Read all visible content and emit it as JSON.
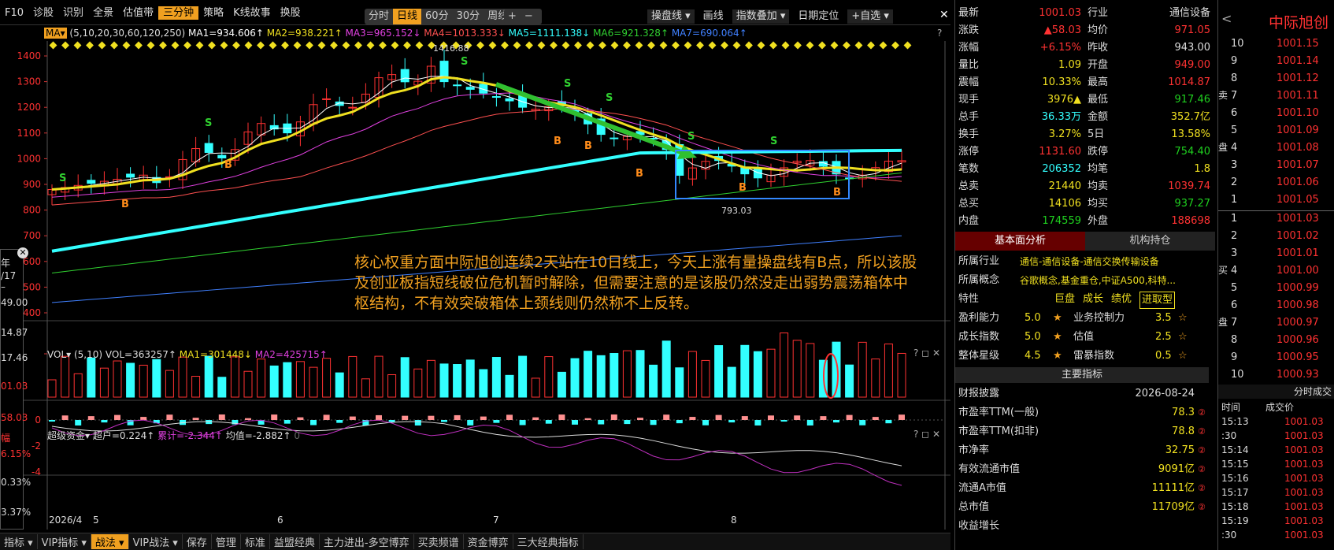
{
  "toolbar": {
    "left": [
      "F10",
      "诊股",
      "识别",
      "全景",
      "估值带",
      "三分钟",
      "策略",
      "K线故事",
      "换股"
    ],
    "active": "三分钟",
    "periods": [
      "分时",
      "日线",
      "60分",
      "30分",
      "周线 ▾"
    ],
    "active_period": "日线",
    "zoom": [
      "+",
      "−"
    ],
    "right": [
      "操盘线 ▾",
      "画线",
      "指数叠加 ▾",
      "日期定位",
      "+自选 ▾"
    ],
    "close": "✕"
  },
  "indicator_line": {
    "ma_btn": "MA▾",
    "params": "(5,10,20,30,60,120,250)",
    "items": [
      {
        "t": "MA1=934.606↑",
        "c": "#ffffff"
      },
      {
        "t": "MA2=938.221↑",
        "c": "#f0e020"
      },
      {
        "t": "MA3=965.152↓",
        "c": "#e040e0"
      },
      {
        "t": "MA4=1013.333↓",
        "c": "#ff5050"
      },
      {
        "t": "MA5=1111.138↓",
        "c": "#33ffff"
      },
      {
        "t": "MA6=921.328↑",
        "c": "#30d030"
      },
      {
        "t": "MA7=690.064↑",
        "c": "#4080ff"
      }
    ],
    "help": "?"
  },
  "price_axis": [
    "1400",
    "1300",
    "1200",
    "1100",
    "1000",
    "900",
    "800",
    "700",
    "600",
    "500",
    "400"
  ],
  "labels": {
    "high": "1416.88",
    "low": "793.03",
    "buy": "B",
    "sell": "S"
  },
  "annotation": "核心权重方面中际旭创连续2天站在10日线上，今天上涨有量操盘线有B点，所以该股及创业板指短线破位危机暂时解除，但需要注意的是该股仍然没走出弱势震荡箱体中枢结构，不有效突破箱体上颈线则仍然称不上反转。",
  "vol_panel": {
    "name": "VOL▾",
    "params": "(5,10)",
    "vol": "VOL=363257↑",
    "ma1": "MA1=301448↓",
    "ma2": "MA2=425715↑",
    "controls": "? ◻ ✕"
  },
  "fund_panel": {
    "name": "超级资金▾",
    "super": "超户=0.224↑",
    "cum": "累计=-2.344↑",
    "avg": "均值=-2.882↑",
    "zero": "0",
    "controls": "? ◻ ✕",
    "axis": [
      "0",
      "-2",
      "-4"
    ]
  },
  "date_axis": [
    "2026/4",
    "5",
    "6",
    "7",
    "8"
  ],
  "left_clip": {
    "lines": [
      "年",
      "/17 –",
      "49.00",
      "14.87",
      "17.46",
      "01.03",
      "58.03",
      "幅",
      "6.15%",
      "0.33%",
      "3.37%"
    ]
  },
  "bottombar": [
    "指标 ▾",
    "VIP指标 ▾",
    "战法 ▾",
    "VIP战法 ▾",
    "保存",
    "管理",
    "标准",
    "益盟经典",
    "主力进出-多空博弈",
    "买卖频谱",
    "资金博弈",
    "三大经典指标"
  ],
  "bottombar_active": "战法 ▾",
  "quote": {
    "rows": [
      [
        [
          "最新",
          "wht"
        ],
        [
          "1001.03",
          "red"
        ],
        [
          "行业",
          "wht"
        ],
        [
          "通信设备",
          "wht"
        ]
      ],
      [
        [
          "涨跌",
          "wht"
        ],
        [
          "▲58.03",
          "red"
        ],
        [
          "均价",
          "wht"
        ],
        [
          "971.05",
          "red"
        ]
      ],
      [
        [
          "涨幅",
          "wht"
        ],
        [
          "+6.15%",
          "red"
        ],
        [
          "昨收",
          "wht"
        ],
        [
          "943.00",
          "wht"
        ]
      ],
      [
        [
          "量比",
          "wht"
        ],
        [
          "1.09",
          "yel"
        ],
        [
          "开盘",
          "wht"
        ],
        [
          "949.00",
          "red"
        ]
      ],
      [
        [
          "震幅",
          "wht"
        ],
        [
          "10.33%",
          "yel"
        ],
        [
          "最高",
          "wht"
        ],
        [
          "1014.87",
          "red"
        ]
      ],
      [
        [
          "现手",
          "wht"
        ],
        [
          "3976▲",
          "yel"
        ],
        [
          "最低",
          "wht"
        ],
        [
          "917.46",
          "grn"
        ]
      ],
      [
        [
          "总手",
          "wht"
        ],
        [
          "36.33万",
          "cyn"
        ],
        [
          "金额",
          "wht"
        ],
        [
          "352.7亿",
          "yel"
        ]
      ],
      [
        [
          "换手",
          "wht"
        ],
        [
          "3.27%",
          "yel"
        ],
        [
          "5日",
          "wht"
        ],
        [
          "13.58%",
          "yel"
        ]
      ],
      [
        [
          "涨停",
          "wht"
        ],
        [
          "1131.60",
          "red"
        ],
        [
          "跌停",
          "wht"
        ],
        [
          "754.40",
          "grn"
        ]
      ],
      [
        [
          "笔数",
          "wht"
        ],
        [
          "206352",
          "cyn"
        ],
        [
          "均笔",
          "wht"
        ],
        [
          "1.8",
          "yel"
        ]
      ],
      [
        [
          "总卖",
          "wht"
        ],
        [
          "21440",
          "yel"
        ],
        [
          "均卖",
          "wht"
        ],
        [
          "1039.74",
          "red"
        ]
      ],
      [
        [
          "总买",
          "wht"
        ],
        [
          "14106",
          "yel"
        ],
        [
          "均买",
          "wht"
        ],
        [
          "937.27",
          "grn"
        ]
      ],
      [
        [
          "内盘",
          "wht"
        ],
        [
          "174559",
          "grn"
        ],
        [
          "外盘",
          "wht"
        ],
        [
          "188698",
          "red"
        ]
      ]
    ]
  },
  "fund_tabs": [
    "基本面分析",
    "机构持仓"
  ],
  "fund": {
    "industry_label": "所属行业",
    "industry": "通信-通信设备-通信交换传输设备",
    "concept_label": "所属概念",
    "concept": "谷歌概念,基金重仓,中证A500,科特...",
    "feature_label": "特性",
    "features": [
      "巨盘",
      "成长",
      "绩优",
      "进取型"
    ],
    "ratings": [
      [
        "盈利能力",
        "5.0",
        "业务控制力",
        "3.5"
      ],
      [
        "成长指数",
        "5.0",
        "估值",
        "2.5"
      ],
      [
        "整体星级",
        "4.5",
        "雷暴指数",
        "0.5"
      ]
    ],
    "main_title": "主要指标",
    "metrics": [
      [
        "财报披露",
        "2026-08-24"
      ],
      [
        "市盈率TTM(一般)",
        "78.3"
      ],
      [
        "市盈率TTM(扣非)",
        "78.8"
      ],
      [
        "市净率",
        "32.75"
      ],
      [
        "有效流通市值",
        "9091亿"
      ],
      [
        "流通A市值",
        "11111亿"
      ],
      [
        "总市值",
        "11709亿"
      ],
      [
        "收益增长",
        ""
      ]
    ]
  },
  "orderbook": {
    "name": "中际旭创",
    "back": "<",
    "sell_label": "卖",
    "sell_label2": "盘",
    "buy_label": "买",
    "buy_label2": "盘",
    "asks": [
      [
        "10",
        "1001.15"
      ],
      [
        "9",
        "1001.14"
      ],
      [
        "8",
        "1001.12"
      ],
      [
        "7",
        "1001.11"
      ],
      [
        "6",
        "1001.10"
      ],
      [
        "5",
        "1001.09"
      ],
      [
        "4",
        "1001.08"
      ],
      [
        "3",
        "1001.07"
      ],
      [
        "2",
        "1001.06"
      ],
      [
        "1",
        "1001.05"
      ]
    ],
    "bids": [
      [
        "1",
        "1001.03"
      ],
      [
        "2",
        "1001.02"
      ],
      [
        "3",
        "1001.01"
      ],
      [
        "4",
        "1001.00"
      ],
      [
        "5",
        "1000.99"
      ],
      [
        "6",
        "1000.98"
      ],
      [
        "7",
        "1000.97"
      ],
      [
        "8",
        "1000.96"
      ],
      [
        "9",
        "1000.95"
      ],
      [
        "10",
        "1000.93"
      ]
    ],
    "tick_title": "分时成交",
    "tick_headers": [
      "时间",
      "成交价"
    ],
    "ticks": [
      [
        "15:13",
        "1001.03"
      ],
      [
        ":30",
        "1001.03"
      ],
      [
        "15:14",
        "1001.03"
      ],
      [
        "15:15",
        "1001.03"
      ],
      [
        "15:16",
        "1001.03"
      ],
      [
        "15:17",
        "1001.03"
      ],
      [
        "15:18",
        "1001.03"
      ],
      [
        "15:19",
        "1001.03"
      ],
      [
        ":30",
        "1001.03"
      ]
    ]
  }
}
